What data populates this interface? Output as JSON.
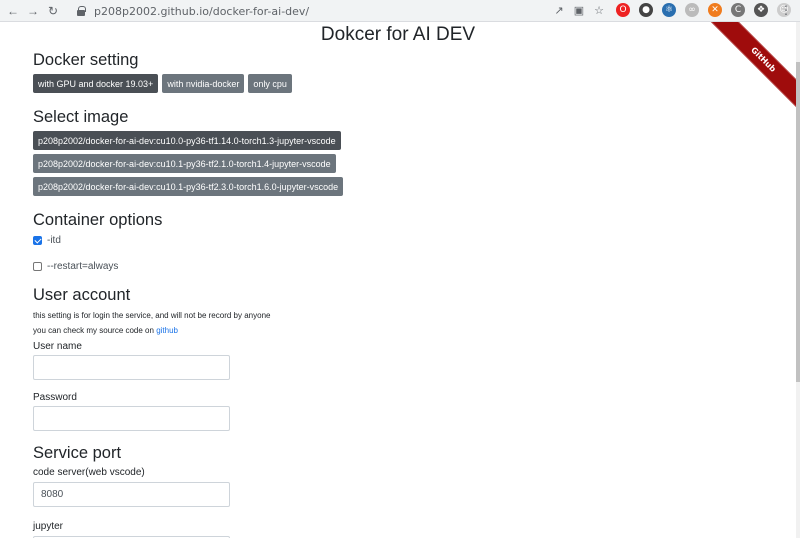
{
  "browser": {
    "url": "p208p2002.github.io/docker-for-ai-dev/",
    "back_icon": "arrow-left",
    "forward_icon": "arrow-right",
    "reload_icon": "reload"
  },
  "page": {
    "title": "Dokcer for AI DEV",
    "ribbon": "GitHub"
  },
  "docker_setting": {
    "heading": "Docker setting",
    "buttons": [
      "with GPU and docker 19.03+",
      "with nvidia-docker",
      "only cpu"
    ]
  },
  "select_image": {
    "heading": "Select image",
    "images": [
      "p208p2002/docker-for-ai-dev:cu10.0-py36-tf1.14.0-torch1.3-jupyter-vscode",
      "p208p2002/docker-for-ai-dev:cu10.1-py36-tf2.1.0-torch1.4-jupyter-vscode",
      "p208p2002/docker-for-ai-dev:cu10.1-py36-tf2.3.0-torch1.6.0-jupyter-vscode"
    ]
  },
  "container_options": {
    "heading": "Container options",
    "options": [
      {
        "label": "-itd",
        "checked": true
      },
      {
        "label": "--restart=always",
        "checked": false
      }
    ]
  },
  "user_account": {
    "heading": "User account",
    "note_1": "this setting is for login the service, and will not be record by anyone",
    "note_2_prefix": "you can check my source code on",
    "note_2_link": "github",
    "username_label": "User name",
    "username_value": "",
    "password_label": "Password",
    "password_value": ""
  },
  "service_port": {
    "heading": "Service port",
    "code_server_label": "code server(web vscode)",
    "code_server_value": "8080",
    "jupyter_label": "jupyter",
    "jupyter_value": ""
  },
  "colors": {
    "button_bg": "#6c757d",
    "button_dark_bg": "#4a4f55",
    "ribbon_bg": "#9f0c0c",
    "link": "#1a73e8"
  }
}
